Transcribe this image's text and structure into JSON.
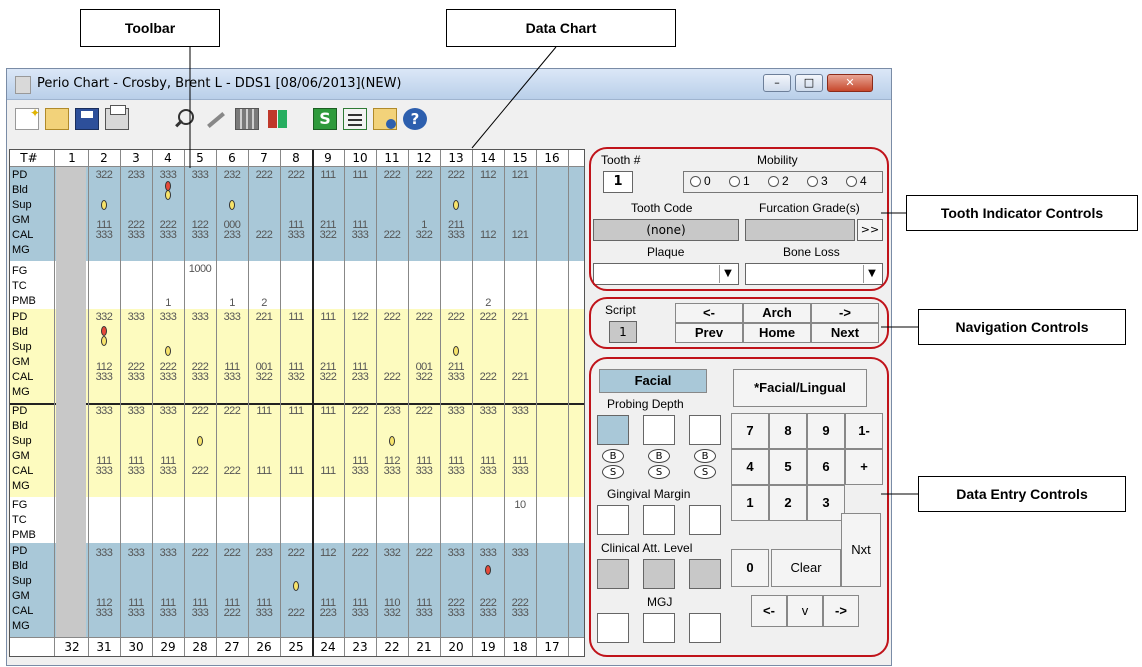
{
  "callouts": {
    "toolbar": "Toolbar",
    "data_chart": "Data Chart",
    "tooth_indicator": "Tooth Indicator Controls",
    "navigation": "Navigation Controls",
    "data_entry": "Data Entry Controls"
  },
  "window": {
    "title": "Perio Chart - Crosby, Brent L - DDS1 [08/06/2013](NEW)",
    "minimize": "–",
    "maximize": "□",
    "close": "✕"
  },
  "toolbar_icons": [
    "new-icon",
    "open-icon",
    "save-icon",
    "print-icon",
    "zoom-icon",
    "tools-icon",
    "calculator-icon",
    "person-icon",
    "script-icon",
    "clipboard-icon",
    "folder-info-icon",
    "help-icon"
  ],
  "chart": {
    "header_label": "T#",
    "upper_teeth": [
      "1",
      "2",
      "3",
      "4",
      "5",
      "6",
      "7",
      "8",
      "9",
      "10",
      "11",
      "12",
      "13",
      "14",
      "15",
      "16"
    ],
    "lower_teeth": [
      "32",
      "31",
      "30",
      "29",
      "28",
      "27",
      "26",
      "25",
      "24",
      "23",
      "22",
      "21",
      "20",
      "19",
      "18",
      "17"
    ],
    "row_labels_a": [
      "PD",
      "Bld",
      "Sup",
      "GM",
      "CAL",
      "MG"
    ],
    "row_labels_b": [
      "FG",
      "TC",
      "PMB"
    ],
    "upper_facial": {
      "pd": [
        "",
        "322",
        "233",
        "333",
        "333",
        "232",
        "222",
        "222",
        "111",
        "111",
        "222",
        "222",
        "222",
        "112",
        "121",
        ""
      ],
      "gm": [
        "",
        "111",
        "222",
        "222",
        "122",
        "000",
        "",
        "111",
        "211",
        "111",
        "",
        "1",
        "211",
        "",
        "",
        ""
      ],
      "cal": [
        "",
        "333",
        "333",
        "333",
        "333",
        "233",
        "222",
        "333",
        "322",
        "333",
        "222",
        "322",
        "333",
        "112",
        "121",
        ""
      ]
    },
    "upper_mid": {
      "fg": [
        "",
        "",
        "",
        "",
        "1000",
        "",
        "",
        "",
        "",
        "",
        "",
        "",
        "",
        "",
        "",
        ""
      ],
      "pmb": [
        "",
        "",
        "",
        "1",
        "",
        "1",
        "2",
        "",
        "",
        "",
        "",
        "",
        "",
        "2",
        "",
        ""
      ]
    },
    "upper_lingual": {
      "pd": [
        "",
        "332",
        "333",
        "333",
        "333",
        "333",
        "221",
        "111",
        "111",
        "122",
        "222",
        "222",
        "222",
        "222",
        "221",
        ""
      ],
      "gm": [
        "",
        "112",
        "222",
        "222",
        "222",
        "111",
        "001",
        "111",
        "211",
        "111",
        "",
        "001",
        "211",
        "",
        "",
        ""
      ],
      "cal": [
        "",
        "333",
        "333",
        "333",
        "333",
        "333",
        "322",
        "332",
        "322",
        "233",
        "222",
        "322",
        "333",
        "222",
        "221",
        ""
      ]
    },
    "lower_lingual": {
      "pd": [
        "",
        "333",
        "333",
        "333",
        "222",
        "222",
        "111",
        "111",
        "111",
        "222",
        "233",
        "222",
        "333",
        "333",
        "333",
        ""
      ],
      "gm": [
        "",
        "111",
        "111",
        "111",
        "",
        "",
        "",
        "",
        "",
        "111",
        "112",
        "111",
        "111",
        "111",
        "111",
        ""
      ],
      "cal": [
        "",
        "333",
        "333",
        "333",
        "222",
        "222",
        "111",
        "111",
        "111",
        "333",
        "333",
        "333",
        "333",
        "333",
        "333",
        ""
      ]
    },
    "lower_mid": {
      "pmb": [
        "",
        "",
        "",
        "",
        "",
        "",
        "",
        "",
        "",
        "",
        "",
        "",
        "",
        "",
        "10",
        ""
      ]
    },
    "lower_facial": {
      "pd": [
        "",
        "333",
        "333",
        "333",
        "222",
        "222",
        "233",
        "222",
        "112",
        "222",
        "332",
        "222",
        "333",
        "333",
        "333",
        ""
      ],
      "gm": [
        "",
        "112",
        "111",
        "111",
        "111",
        "111",
        "111",
        "",
        "111",
        "111",
        "110",
        "111",
        "222",
        "222",
        "222",
        ""
      ],
      "cal": [
        "",
        "333",
        "333",
        "333",
        "333",
        "222",
        "333",
        "222",
        "223",
        "333",
        "332",
        "333",
        "333",
        "333",
        "333",
        ""
      ]
    }
  },
  "panel": {
    "tooth_label": "Tooth #",
    "tooth_value": "1",
    "mobility_label": "Mobility",
    "mobility_options": [
      "0",
      "1",
      "2",
      "3",
      "4"
    ],
    "tooth_code_label": "Tooth Code",
    "tooth_code_value": "(none)",
    "furcation_label": "Furcation Grade(s)",
    "furcation_button": ">>",
    "plaque_label": "Plaque",
    "bone_loss_label": "Bone Loss",
    "script_label": "Script",
    "script_value": "1",
    "nav_prev_arrow": "<-",
    "nav_prev": "Prev",
    "nav_arch": "Arch",
    "nav_home": "Home",
    "nav_next_arrow": "->",
    "nav_next": "Next",
    "facial": "Facial",
    "facial_lingual": "*Facial/Lingual",
    "probing_depth": "Probing Depth",
    "gingival_margin": "Gingival Margin",
    "clinical_att": "Clinical Att. Level",
    "mgj": "MGJ",
    "b": "B",
    "s": "S",
    "keypad": [
      "7",
      "8",
      "9",
      "1-",
      "4",
      "5",
      "6",
      "+",
      "1",
      "2",
      "3",
      "0"
    ],
    "clear": "Clear",
    "nxt": "Nxt",
    "arrow_left": "<-",
    "arrow_down": "v",
    "arrow_right": "->"
  },
  "colors": {
    "blue_band": "#a9c8d8",
    "yellow_band": "#fdfbbf",
    "outline_red": "#c0131a"
  }
}
